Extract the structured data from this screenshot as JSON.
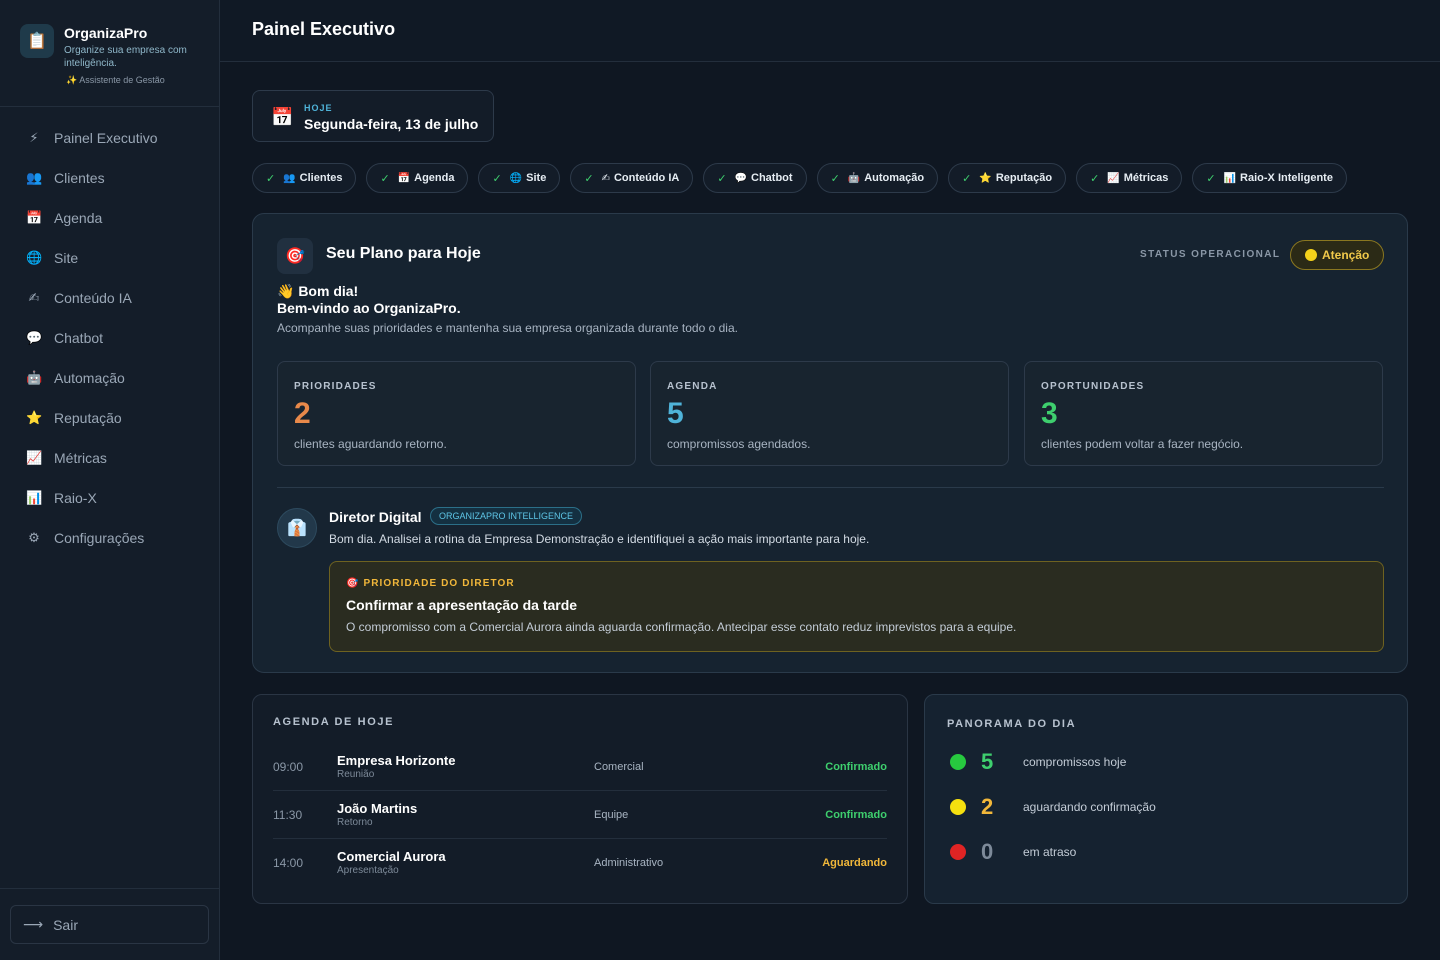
{
  "brand": {
    "name": "OrganizaPro",
    "tagline": "Organize sua empresa com inteligência.",
    "subtitle": "Assistente de Gestão"
  },
  "sidebar": {
    "items": [
      {
        "label": "Painel Executivo",
        "icon": "⚡"
      },
      {
        "label": "Clientes",
        "icon": "👥"
      },
      {
        "label": "Agenda",
        "icon": "📅"
      },
      {
        "label": "Site",
        "icon": "🌐"
      },
      {
        "label": "Conteúdo IA",
        "icon": "✍"
      },
      {
        "label": "Chatbot",
        "icon": "💬"
      },
      {
        "label": "Automação",
        "icon": "🤖"
      },
      {
        "label": "Reputação",
        "icon": "⭐"
      },
      {
        "label": "Métricas",
        "icon": "📈"
      },
      {
        "label": "Raio-X",
        "icon": "📊"
      },
      {
        "label": "Configurações",
        "icon": "⚙"
      }
    ],
    "logout_label": "Sair"
  },
  "header": {
    "title": "Painel Executivo"
  },
  "today": {
    "label": "HOJE",
    "date": "Segunda-feira, 13 de julho"
  },
  "modules": [
    {
      "label": "Clientes",
      "icon": "👥"
    },
    {
      "label": "Agenda",
      "icon": "📅"
    },
    {
      "label": "Site",
      "icon": "🌐"
    },
    {
      "label": "Conteúdo IA",
      "icon": "✍"
    },
    {
      "label": "Chatbot",
      "icon": "💬"
    },
    {
      "label": "Automação",
      "icon": "🤖"
    },
    {
      "label": "Reputação",
      "icon": "⭐"
    },
    {
      "label": "Métricas",
      "icon": "📈"
    },
    {
      "label": "Raio-X Inteligente",
      "icon": "📊"
    }
  ],
  "plan": {
    "title": "Seu Plano para Hoje",
    "status_label": "STATUS OPERACIONAL",
    "status_value": "Atenção",
    "greeting": "👋 Bom dia!",
    "welcome": "Bem-vindo ao OrganizaPro.",
    "intro": "Acompanhe suas prioridades e mantenha sua empresa organizada durante todo o dia.",
    "stats": [
      {
        "label": "PRIORIDADES",
        "value": "2",
        "desc": "clientes aguardando retorno.",
        "color": "#e8894a"
      },
      {
        "label": "AGENDA",
        "value": "5",
        "desc": "compromissos agendados.",
        "color": "#4fb3d9"
      },
      {
        "label": "OPORTUNIDADES",
        "value": "3",
        "desc": "clientes podem voltar a fazer negócio.",
        "color": "#3ecf6e"
      }
    ]
  },
  "director": {
    "name": "Diretor Digital",
    "badge": "ORGANIZAPRO INTELLIGENCE",
    "message": "Bom dia. Analisei a rotina da Empresa Demonstração e identifiquei a ação mais importante para hoje.",
    "priority_label": "PRIORIDADE DO DIRETOR",
    "priority_title": "Confirmar a apresentação da tarde",
    "priority_desc": "O compromisso com a Comercial Aurora ainda aguarda confirmação. Antecipar esse contato reduz imprevistos para a equipe."
  },
  "agenda": {
    "title": "AGENDA DE HOJE",
    "rows": [
      {
        "time": "09:00",
        "name": "Empresa Horizonte",
        "type": "Reunião",
        "dept": "Comercial",
        "status": "Confirmado",
        "status_color": "#3ecf6e"
      },
      {
        "time": "11:30",
        "name": "João Martins",
        "type": "Retorno",
        "dept": "Equipe",
        "status": "Confirmado",
        "status_color": "#3ecf6e"
      },
      {
        "time": "14:00",
        "name": "Comercial Aurora",
        "type": "Apresentação",
        "dept": "Administrativo",
        "status": "Aguardando",
        "status_color": "#f1b73a"
      }
    ]
  },
  "panorama": {
    "title": "PANORAMA DO DIA",
    "rows": [
      {
        "value": "5",
        "text": "compromissos hoje",
        "color": "#3ecf6e",
        "dot": "#27c93f"
      },
      {
        "value": "2",
        "text": "aguardando confirmação",
        "color": "#f1b73a",
        "dot": "#f5e00f"
      },
      {
        "value": "0",
        "text": "em atraso",
        "color": "#7d8a99",
        "dot": "#e02424"
      }
    ]
  }
}
